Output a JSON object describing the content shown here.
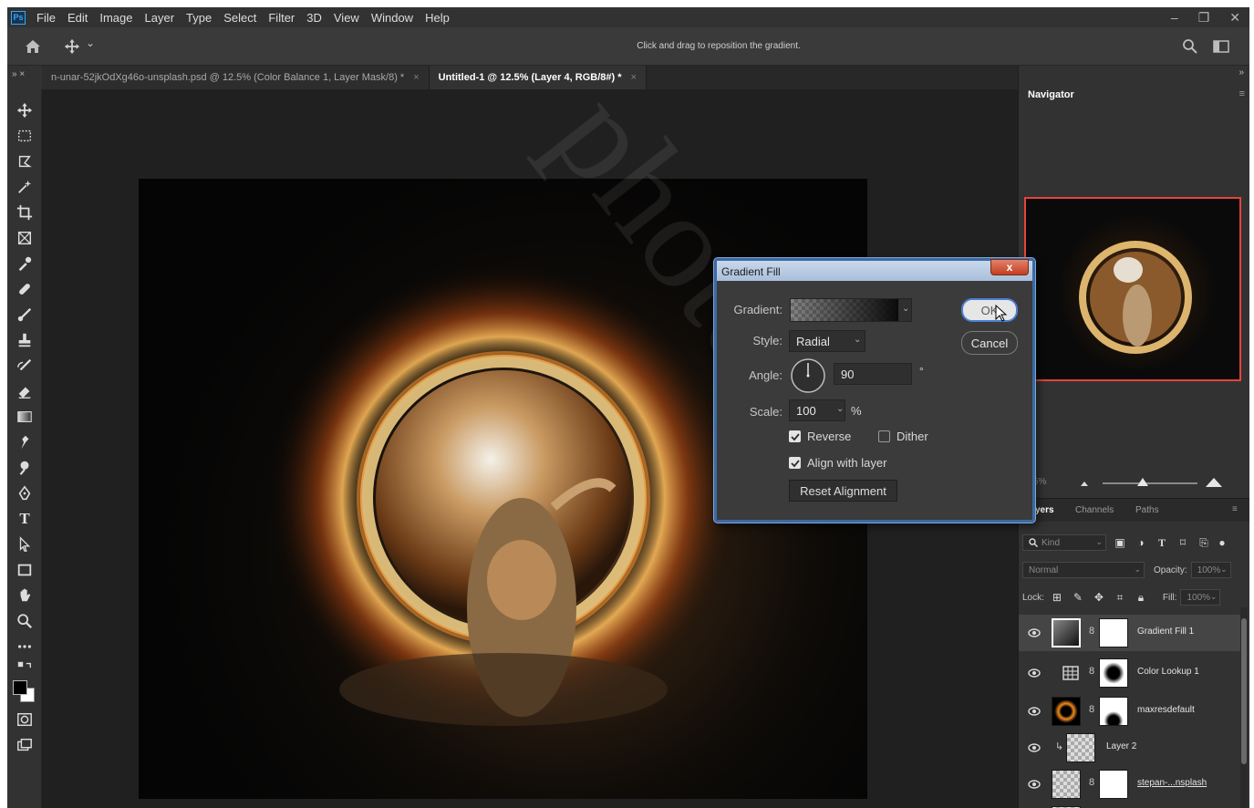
{
  "app": {
    "logo": "Ps"
  },
  "menubar": {
    "items": [
      "File",
      "Edit",
      "Image",
      "Layer",
      "Type",
      "Select",
      "Filter",
      "3D",
      "View",
      "Window",
      "Help"
    ],
    "win_controls": [
      "–",
      "❐",
      "✕"
    ]
  },
  "optionsbar": {
    "hint": "Click and drag to reposition the gradient.",
    "move_chevron": "⌄"
  },
  "tabs": [
    {
      "label": "n-unar-52jkOdXg46o-unsplash.psd @ 12.5% (Color Balance 1, Layer Mask/8) *",
      "close": "×",
      "active": false
    },
    {
      "label": "Untitled-1 @ 12.5% (Layer 4, RGB/8#) *",
      "close": "×",
      "active": true
    }
  ],
  "panel_collapse": "»",
  "tool_collapse": "» ×",
  "navigator": {
    "title": "Navigator",
    "menu": "≡",
    "zoom_pct": "5%"
  },
  "layers_panel": {
    "tabs": [
      "yers",
      "Channels",
      "Paths"
    ],
    "menu": "≡",
    "kind_label": "Kind",
    "blend_mode": "Normal",
    "opacity_label": "Opacity:",
    "opacity_value": "100%",
    "lock_label": "Lock:",
    "fill_label": "Fill:",
    "fill_value": "100%",
    "layers": [
      {
        "name": "Gradient Fill 1",
        "selected": true
      },
      {
        "name": "Color Lookup 1",
        "selected": false
      },
      {
        "name": "maxresdefault",
        "selected": false
      },
      {
        "name": "Layer 2",
        "selected": false
      },
      {
        "name": "stepan-...nsplash",
        "selected": false
      }
    ]
  },
  "dialog": {
    "title": "Gradient Fill",
    "close": "x",
    "gradient_label": "Gradient:",
    "style_label": "Style:",
    "style_value": "Radial",
    "angle_label": "Angle:",
    "angle_value": "90",
    "angle_unit": "°",
    "scale_label": "Scale:",
    "scale_value": "100",
    "scale_unit": "%",
    "reverse_label": "Reverse",
    "reverse_checked": true,
    "dither_label": "Dither",
    "dither_checked": false,
    "align_label": "Align with layer",
    "align_checked": true,
    "reset_label": "Reset Alignment",
    "ok_label": "OK",
    "cancel_label": "Cancel"
  },
  "watermark": "photosh"
}
